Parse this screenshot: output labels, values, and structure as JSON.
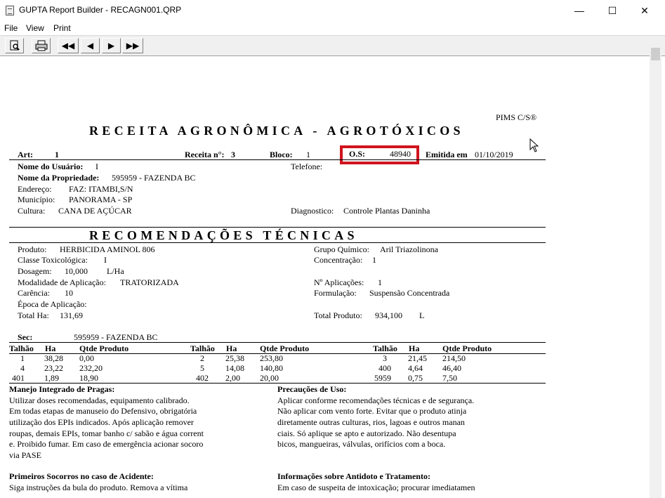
{
  "window": {
    "title": "GUPTA Report Builder - RECAGN001.QRP",
    "minimize": "—",
    "maximize": "☐",
    "close": "✕"
  },
  "menu": {
    "file": "File",
    "view": "View",
    "print": "Print"
  },
  "toolbar": {
    "first": "◀◀",
    "prev": "◀",
    "next": "▶",
    "last": "▶▶"
  },
  "report": {
    "brand": "PIMS C/S®",
    "title": "RECEITA AGRONÔMICA - AGROTÓXICOS",
    "art_label": "Art:",
    "art_value": "1",
    "receita_label": "Receita n°:",
    "receita_value": "3",
    "bloco_label": "Bloco:",
    "bloco_value": "1",
    "os_label": "O.S:",
    "os_value": "48940",
    "emitida_label": "Emitida em",
    "emitida_value": "01/10/2019",
    "usuario_label": "Nome do Usuário:",
    "usuario_value": "I",
    "telefone_label": "Telefone:",
    "propriedade_label": "Nome da Propriedade:",
    "propriedade_value": "595959 - FAZENDA BC",
    "endereco_label": "Endereço:",
    "endereco_value": "FAZ: ITAMBI,S/N",
    "municipio_label": "Município:",
    "municipio_value": "PANORAMA - SP",
    "cultura_label": "Cultura:",
    "cultura_value": "CANA DE AÇÚCAR",
    "diagnostico_label": "Diagnostico:",
    "diagnostico_value": "Controle Plantas Daninha",
    "rec_title": "RECOMENDAÇÕES TÉCNICAS",
    "produto_label": "Produto:",
    "produto_value": "HERBICIDA AMINOL 806",
    "grupo_label": "Grupo Químico:",
    "grupo_value": "Aril Triazolinona",
    "classe_label": "Classe Toxicológica:",
    "classe_value": "I",
    "concentracao_label": "Concentração:",
    "concentracao_value": "1",
    "dosagem_label": "Dosagem:",
    "dosagem_value": "10,000",
    "dosagem_unit": "L/Ha",
    "modalidade_label": "Modalidade de Aplicação:",
    "modalidade_value": "TRATORIZADA",
    "aplicacoes_label": "Nº Aplicações:",
    "aplicacoes_value": "1",
    "carencia_label": "Carência:",
    "carencia_value": "10",
    "formulacao_label": "Formulação:",
    "formulacao_value": "Suspensão Concentrada",
    "epoca_label": "Época de Aplicação:",
    "totalha_label": "Total Ha:",
    "totalha_value": "131,69",
    "totalprod_label": "Total Produto:",
    "totalprod_value": "934,100",
    "totalprod_unit": "L",
    "sec_label": "Sec:",
    "sec_value": "595959 - FAZENDA BC",
    "table_headers": {
      "talhao": "Talhão",
      "ha": "Ha",
      "qtde": "Qtde Produto"
    },
    "table": [
      {
        "t1": "1",
        "h1": "38,28",
        "q1": "0,00",
        "t2": "2",
        "h2": "25,38",
        "q2": "253,80",
        "t3": "3",
        "h3": "21,45",
        "q3": "214,50"
      },
      {
        "t1": "4",
        "h1": "23,22",
        "q1": "232,20",
        "t2": "5",
        "h2": "14,08",
        "q2": "140,80",
        "t3": "400",
        "h3": "4,64",
        "q3": "46,40"
      },
      {
        "t1": "401",
        "h1": "1,89",
        "q1": "18,90",
        "t2": "402",
        "h2": "2,00",
        "q2": "20,00",
        "t3": "5959",
        "h3": "0,75",
        "q3": "7,50"
      }
    ],
    "manejo_title": "Manejo Integrado de Pragas:",
    "manejo_lines": [
      "Utilizar doses recomendadas, equipamento calibrado.",
      "Em todas etapas de manuseio do Defensivo, obrigatória",
      "utilização dos EPIs indicados. Após aplicação remover",
      "roupas, demais EPIs, tomar banho c/ sabão e água corrent",
      "e. Proibido fumar. Em caso de emergência acionar socoro",
      "via PASE"
    ],
    "precaucoes_title": "Precauções de Uso:",
    "precaucoes_lines": [
      "Aplicar conforme recomendações técnicas e de segurança.",
      "Não aplicar com vento forte. Evitar que o produto atinja",
      "diretamente outras culturas, rios, lagoas e outros manan",
      "ciais. Só aplique se apto e autorizado. Não desentupa",
      "bicos, mangueiras, válvulas, orifícios com a boca."
    ],
    "socorros_title": "Primeiros Socorros no caso de Acidente:",
    "socorros_line": "Siga instruções da bula do produto. Remova a vítima",
    "antidoto_title": "Informações sobre Antidoto e Tratamento:",
    "antidoto_line": "Em caso de suspeita de intoxicação; procurar imediatamen"
  }
}
